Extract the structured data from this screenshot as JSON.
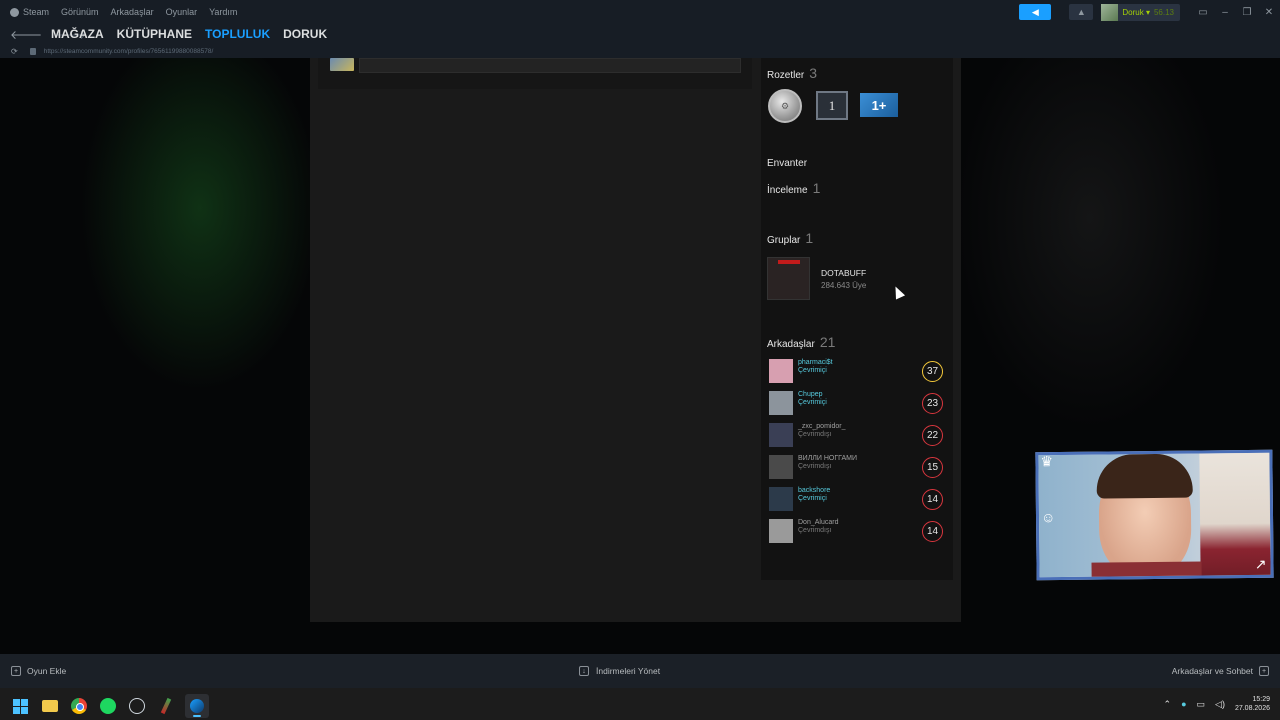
{
  "menu": {
    "items": [
      "Steam",
      "Görünüm",
      "Arkadaşlar",
      "Oyunlar",
      "Yardım"
    ]
  },
  "account": {
    "name": "Doruk",
    "balance": "56.13"
  },
  "nav": {
    "tabs": [
      "MAĞAZA",
      "KÜTÜPHANE",
      "TOPLULUK",
      "DORUK"
    ],
    "active": "TOPLULUK"
  },
  "url": "https://steamcommunity.com/profiles/76561199880088578/",
  "profile": {
    "badges": {
      "label": "Rozetler",
      "count": "3",
      "badge_level_1": "1",
      "badge_level_2": "1+"
    },
    "inventory": {
      "label": "Envanter"
    },
    "reviews": {
      "label": "İnceleme",
      "count": "1"
    },
    "groups": {
      "label": "Gruplar",
      "count": "1",
      "items": [
        {
          "name": "DOTABUFF",
          "members": "284.643 Üye"
        }
      ]
    },
    "friends": {
      "label": "Arkadaşlar",
      "count": "21",
      "items": [
        {
          "name": "pharmaci$t",
          "status": "Çevrimiçi",
          "level": "37",
          "online": true,
          "level_color": "#f5c93a",
          "avatar_color": "#d79fb0"
        },
        {
          "name": "Chupep",
          "status": "Çevrimiçi",
          "level": "23",
          "online": true,
          "level_color": "#d9363e",
          "avatar_color": "#8c949c"
        },
        {
          "name": "_zxc_pomidor_",
          "status": "Çevrimdışı",
          "level": "22",
          "online": false,
          "level_color": "#d9363e",
          "avatar_color": "#3a3f55"
        },
        {
          "name": "ВИЛЛИ НОГГАМИ",
          "status": "Çevrimdışı",
          "level": "15",
          "online": false,
          "level_color": "#d9363e",
          "avatar_color": "#4a4a4a"
        },
        {
          "name": "backshore",
          "status": "Çevrimiçi",
          "level": "14",
          "online": true,
          "level_color": "#d9363e",
          "avatar_color": "#2c3a4a"
        },
        {
          "name": "Don_Alucard",
          "status": "Çevrimdışı",
          "level": "14",
          "online": false,
          "level_color": "#d9363e",
          "avatar_color": "#9a9a9a"
        }
      ]
    }
  },
  "bottombar": {
    "add_game": "Oyun Ekle",
    "downloads": "İndirmeleri Yönet",
    "friends_chat": "Arkadaşlar ve Sohbet"
  },
  "taskbar": {
    "time": "15:29",
    "date": "27.08.2026"
  },
  "colors": {
    "accent": "#1a9fff",
    "online": "#57cbde",
    "wallet": "#a4d007"
  }
}
